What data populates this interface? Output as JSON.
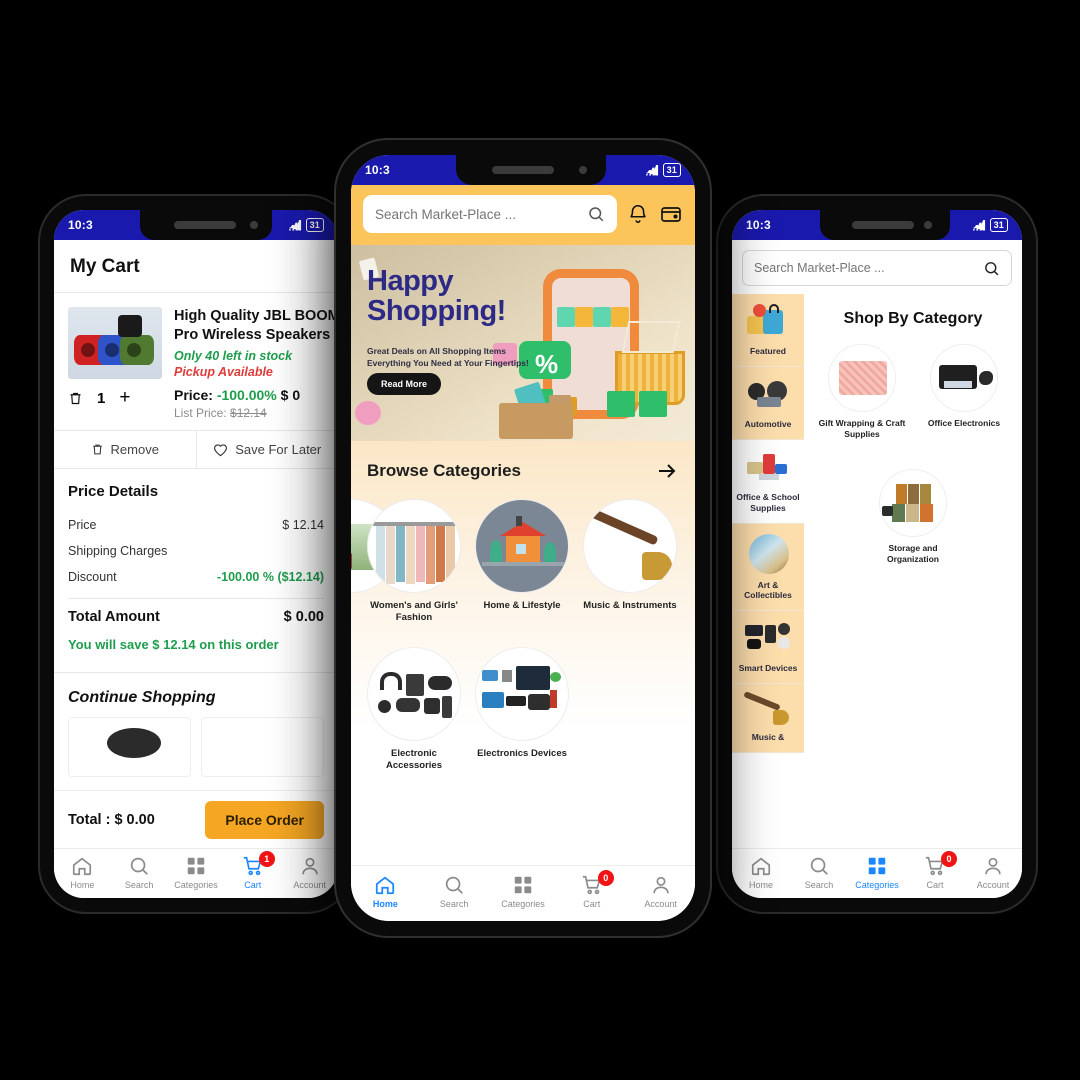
{
  "statusbar": {
    "time": "10:3",
    "battery": "31"
  },
  "colors": {
    "status_bar": "#1a19ad",
    "accent_orange": "#f5a623",
    "banner_yellow": "#fcc55b",
    "active_blue": "#1a86ff",
    "green": "#1f9d4d",
    "red": "#e03b3b",
    "badge_red": "#f01414",
    "sidebar_selected": "#fcddac"
  },
  "cart_screen": {
    "title": "My Cart",
    "product": {
      "name_line1": "High Quality JBL BOOMBOX",
      "name_line2": "Pro Wireless Speakers  L",
      "stock": "Only 40 left in stock",
      "pickup": "Pickup Available",
      "quantity": "1",
      "plus": "+",
      "price_label": "Price:",
      "discount_pct": "-100.00%",
      "price_value": "$ 0",
      "list_price_label": "List Price:",
      "list_price_value": "$12.14"
    },
    "actions": {
      "remove": "Remove",
      "save_for_later": "Save For Later"
    },
    "price_details": {
      "heading": "Price Details",
      "rows": [
        {
          "label": "Price",
          "value": "$ 12.14"
        },
        {
          "label": "Shipping Charges",
          "value": ""
        },
        {
          "label": "Discount",
          "value": "-100.00 % ($12.14)"
        }
      ],
      "total_label": "Total Amount",
      "total_value": "$ 0.00",
      "savings": "You will save $ 12.14 on this order"
    },
    "continue_shopping": "Continue Shopping",
    "checkout": {
      "total_label": "Total :",
      "total_value": "$ 0.00",
      "button": "Place Order"
    },
    "nav": [
      {
        "label": "Home",
        "icon": "home-icon",
        "active": false,
        "badge": ""
      },
      {
        "label": "Search",
        "icon": "search-icon",
        "active": false,
        "badge": ""
      },
      {
        "label": "Categories",
        "icon": "grid-icon",
        "active": false,
        "badge": ""
      },
      {
        "label": "Cart",
        "icon": "cart-icon",
        "active": true,
        "badge": "1"
      },
      {
        "label": "Account",
        "icon": "account-icon",
        "active": false,
        "badge": ""
      }
    ]
  },
  "home_screen": {
    "search_placeholder": "Search Market-Place ...",
    "icons": {
      "search": "search-icon",
      "bell": "bell-icon",
      "wallet": "wallet-icon"
    },
    "banner": {
      "headline_line1": "Happy",
      "headline_line2": "Shopping!",
      "sub_line1": "Great Deals on All Shopping Items",
      "sub_line2": "Everything You Need at Your Fingertips!",
      "button": "Read More"
    },
    "categories_heading": "Browse Categories",
    "arrow_icon": "arrow-right-icon",
    "categories": [
      {
        "label": "Women's and Girls' Fashion"
      },
      {
        "label": "Home & Lifestyle"
      },
      {
        "label": "Music & Instruments"
      },
      {
        "label": "Electronic Accessories"
      },
      {
        "label": "Electronics Devices"
      }
    ],
    "nav": [
      {
        "label": "Home",
        "icon": "home-icon",
        "active": true,
        "badge": ""
      },
      {
        "label": "Search",
        "icon": "search-icon",
        "active": false,
        "badge": ""
      },
      {
        "label": "Categories",
        "icon": "grid-icon",
        "active": false,
        "badge": ""
      },
      {
        "label": "Cart",
        "icon": "cart-icon",
        "active": false,
        "badge": "0"
      },
      {
        "label": "Account",
        "icon": "account-icon",
        "active": false,
        "badge": ""
      }
    ]
  },
  "category_screen": {
    "search_placeholder": "Search Market-Place ...",
    "heading": "Shop By Category",
    "sidebar": [
      {
        "label": "Featured",
        "selected": true
      },
      {
        "label": "Automotive",
        "selected": true
      },
      {
        "label": "Office & School Supplies",
        "selected": false
      },
      {
        "label": "Art & Collectibles",
        "selected": true
      },
      {
        "label": "Smart Devices",
        "selected": true
      },
      {
        "label": "Music &",
        "selected": true
      }
    ],
    "items": [
      {
        "label": "Gift Wrapping & Craft Supplies"
      },
      {
        "label": "Office Electronics"
      },
      {
        "label": "Storage and Organization"
      }
    ],
    "nav": [
      {
        "label": "Home",
        "icon": "home-icon",
        "active": false,
        "badge": ""
      },
      {
        "label": "Search",
        "icon": "search-icon",
        "active": false,
        "badge": ""
      },
      {
        "label": "Categories",
        "icon": "grid-icon",
        "active": true,
        "badge": ""
      },
      {
        "label": "Cart",
        "icon": "cart-icon",
        "active": false,
        "badge": "0"
      },
      {
        "label": "Account",
        "icon": "account-icon",
        "active": false,
        "badge": ""
      }
    ]
  }
}
